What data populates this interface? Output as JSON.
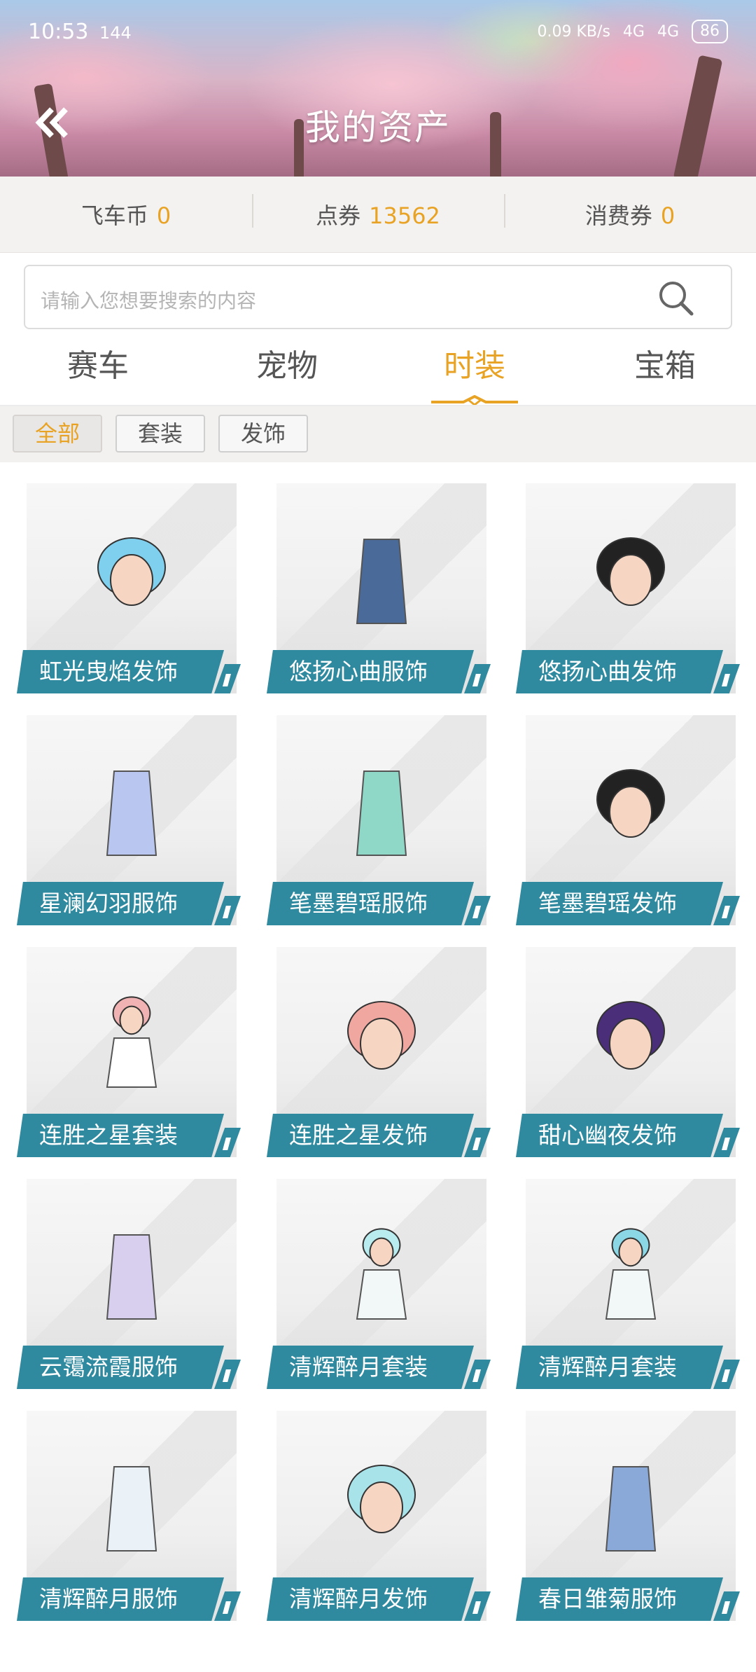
{
  "status": {
    "time": "10:53",
    "network": "144",
    "speed": "0.09 KB/s",
    "signal1": "4G",
    "signal2": "4G",
    "battery": "86"
  },
  "header": {
    "title": "我的资产"
  },
  "currency": [
    {
      "label": "飞车币",
      "value": "0"
    },
    {
      "label": "点券",
      "value": "13562"
    },
    {
      "label": "消费券",
      "value": "0"
    }
  ],
  "search": {
    "placeholder": "请输入您想要搜索的内容"
  },
  "tabs": [
    "赛车",
    "宠物",
    "时装",
    "宝箱"
  ],
  "active_tab": "时装",
  "filters": [
    "全部",
    "套装",
    "发饰"
  ],
  "active_filter": "全部",
  "items": [
    {
      "name": "虹光曳焰发饰",
      "hair": "#7fd0ee",
      "body": "none"
    },
    {
      "name": "悠扬心曲服饰",
      "hair": "none",
      "body": "#4a6a9a"
    },
    {
      "name": "悠扬心曲发饰",
      "hair": "#222222",
      "body": "none"
    },
    {
      "name": "星澜幻羽服饰",
      "hair": "none",
      "body": "#b9c6f0"
    },
    {
      "name": "笔墨碧瑶服饰",
      "hair": "none",
      "body": "#8fd8c8"
    },
    {
      "name": "笔墨碧瑶发饰",
      "hair": "#222222",
      "body": "none"
    },
    {
      "name": "连胜之星套装",
      "hair": "#f0b2b2",
      "body": "#ffffff"
    },
    {
      "name": "连胜之星发饰",
      "hair": "#f0a7a0",
      "body": "none"
    },
    {
      "name": "甜心幽夜发饰",
      "hair": "#4a2e7a",
      "body": "none"
    },
    {
      "name": "云霭流霞服饰",
      "hair": "none",
      "body": "#d8cfee"
    },
    {
      "name": "清辉醉月套装",
      "hair": "#b8ecef",
      "body": "#f2f7f7"
    },
    {
      "name": "清辉醉月套装",
      "hair": "#8cd7e6",
      "body": "#f2f7f7"
    },
    {
      "name": "清辉醉月服饰",
      "hair": "none",
      "body": "#eaf2f8"
    },
    {
      "name": "清辉醉月发饰",
      "hair": "#a9e3ea",
      "body": "none"
    },
    {
      "name": "春日雏菊服饰",
      "hair": "none",
      "body": "#8aa8d8"
    }
  ],
  "colors": {
    "accent": "#e8a325",
    "label_bg": "#2f8a9f"
  }
}
